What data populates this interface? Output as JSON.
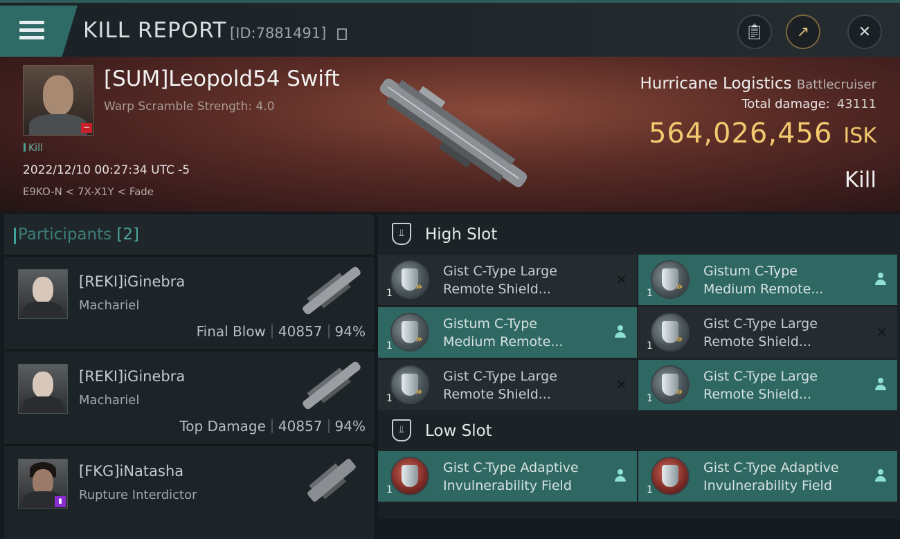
{
  "header": {
    "title": "KILL REPORT",
    "kill_id": "[ID:7881491]",
    "buttons": [
      "clipboard-icon",
      "share-icon",
      "close-icon"
    ]
  },
  "victim": {
    "name": "[SUM]Leopold54 Swift",
    "warp": "Warp Scramble Strength: 4.0",
    "tag": "Kill",
    "date": "2022/12/10 00:27:34 UTC -5",
    "location": "E9KO-N < 7X-X1Y < Fade",
    "ship": "Hurricane Logistics",
    "ship_class": "Battlecruiser",
    "total_damage_label": "Total damage:",
    "total_damage": "43111",
    "isk_value": "564,026,456",
    "isk_unit": "ISK",
    "result": "Kill"
  },
  "participants": {
    "label": "Participants",
    "count": "[2]",
    "rows": [
      {
        "name": "[REKI]iGinebra",
        "ship": "Machariel",
        "role": "Final Blow",
        "damage": "40857",
        "percent": "94%"
      },
      {
        "name": "[REKI]iGinebra",
        "ship": "Machariel",
        "role": "Top Damage",
        "damage": "40857",
        "percent": "94%"
      },
      {
        "name": "[FKG]iNatasha",
        "ship": "Rupture Interdictor"
      }
    ]
  },
  "slots": {
    "high_label": "High Slot",
    "low_label": "Low Slot",
    "high": [
      {
        "qty": "1",
        "line1": "Gist C-Type Large",
        "line2": "Remote Shield...",
        "state": "destroyed"
      },
      {
        "qty": "1",
        "line1": "Gistum C-Type",
        "line2": "Medium Remote...",
        "state": "dropped"
      },
      {
        "qty": "1",
        "line1": "Gistum C-Type",
        "line2": "Medium Remote...",
        "state": "dropped"
      },
      {
        "qty": "1",
        "line1": "Gist C-Type Large",
        "line2": "Remote Shield...",
        "state": "destroyed"
      },
      {
        "qty": "1",
        "line1": "Gist C-Type Large",
        "line2": "Remote Shield...",
        "state": "destroyed"
      },
      {
        "qty": "1",
        "line1": "Gist C-Type Large",
        "line2": "Remote Shield...",
        "state": "dropped"
      }
    ],
    "low": [
      {
        "qty": "1",
        "line1": "Gist C-Type Adaptive",
        "line2": "Invulnerability Field",
        "state": "dropped"
      },
      {
        "qty": "1",
        "line1": "Gist C-Type Adaptive",
        "line2": "Invulnerability Field",
        "state": "dropped"
      }
    ]
  },
  "colors": {
    "accent": "#2f6863",
    "isk": "#f2c96e",
    "destroy": "#c8202a"
  }
}
